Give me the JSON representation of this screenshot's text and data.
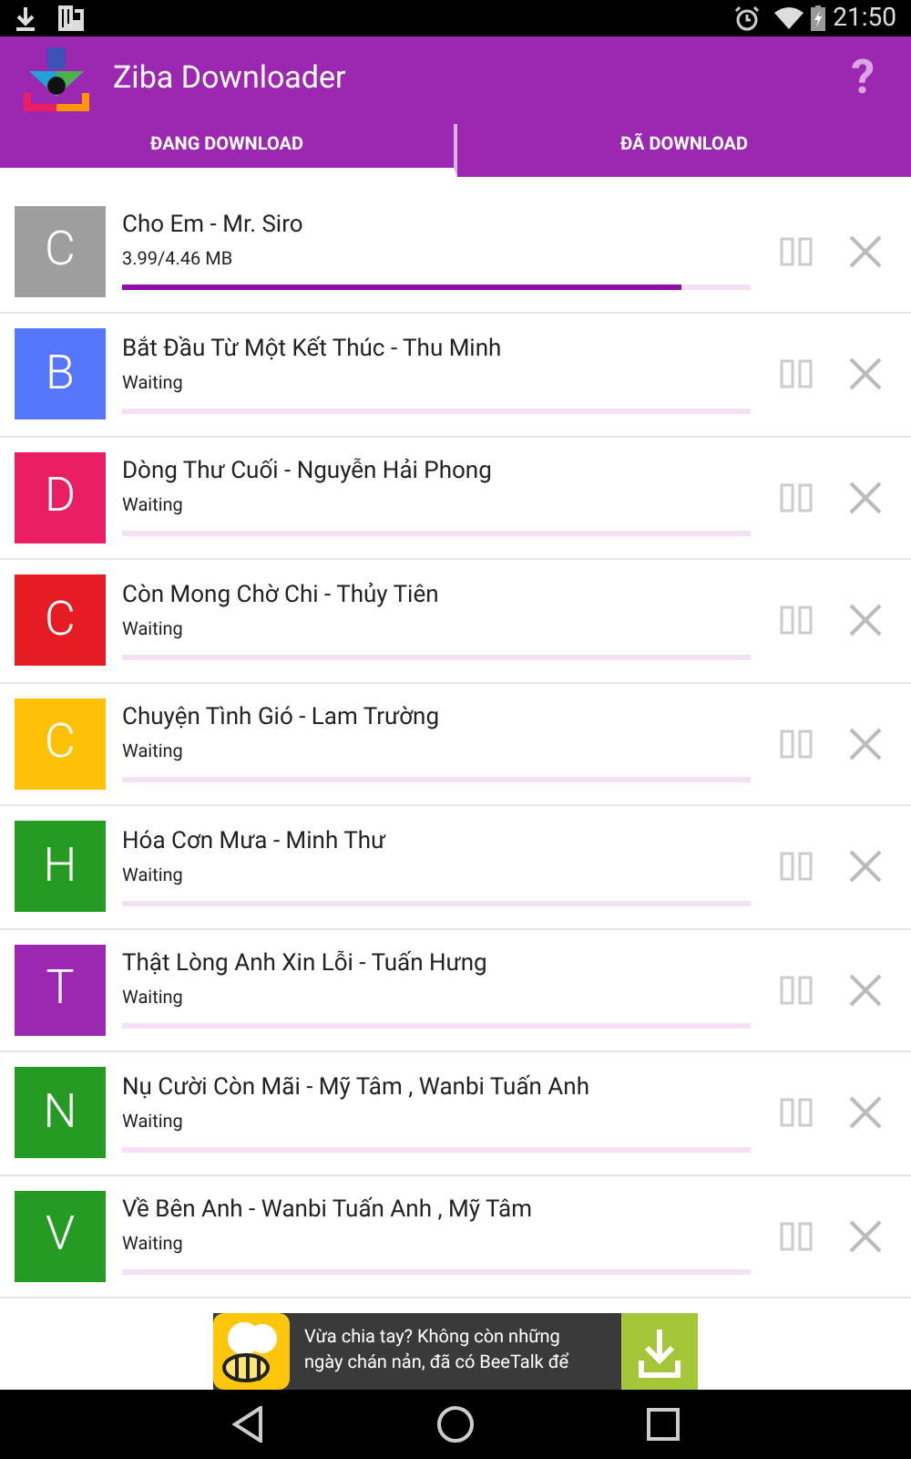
{
  "status_bar": {
    "time": "21:50"
  },
  "app_bar": {
    "title": "Ziba Downloader",
    "help": "?"
  },
  "tabs": [
    {
      "label": "ĐANG DOWNLOAD",
      "selected": true
    },
    {
      "label": "ĐÃ DOWNLOAD",
      "selected": false
    }
  ],
  "downloads": [
    {
      "letter": "C",
      "color": "#9e9e9e",
      "title": "Cho Em - Mr. Siro",
      "status": "3.99/4.46 MB",
      "level": 0.89
    },
    {
      "letter": "B",
      "color": "#5677fc",
      "title": "Bắt Đầu Từ Một Kết Thúc - Thu Minh",
      "status": "Waiting"
    },
    {
      "letter": "D",
      "color": "#e91e63",
      "title": "Dòng Thư Cuối - Nguyễn Hải Phong",
      "status": "Waiting"
    },
    {
      "letter": "C",
      "color": "#e51c23",
      "title": "Còn Mong Chờ Chi - Thủy Tiên",
      "status": "Waiting"
    },
    {
      "letter": "C",
      "color": "#ffc107",
      "title": "Chuyện Tình Gió - Lam Trường",
      "status": "Waiting"
    },
    {
      "letter": "H",
      "color": "#259b24",
      "title": "Hóa Cơn Mưa - Minh Thư",
      "status": "Waiting"
    },
    {
      "letter": "T",
      "color": "#9c27b0",
      "title": "Thật Lòng Anh Xin Lỗi - Tuấn Hưng",
      "status": "Waiting"
    },
    {
      "letter": "N",
      "color": "#259b24",
      "title": "Nụ Cười Còn Mãi - Mỹ Tâm , Wanbi Tuấn Anh",
      "status": "Waiting"
    },
    {
      "letter": "V",
      "color": "#259b24",
      "title": "Về Bên Anh - Wanbi Tuấn Anh , Mỹ Tâm",
      "status": "Waiting"
    }
  ],
  "ad": {
    "text": "Vừa chia tay? Không còn những ngày chán nản, đã có BeeTalk để"
  }
}
